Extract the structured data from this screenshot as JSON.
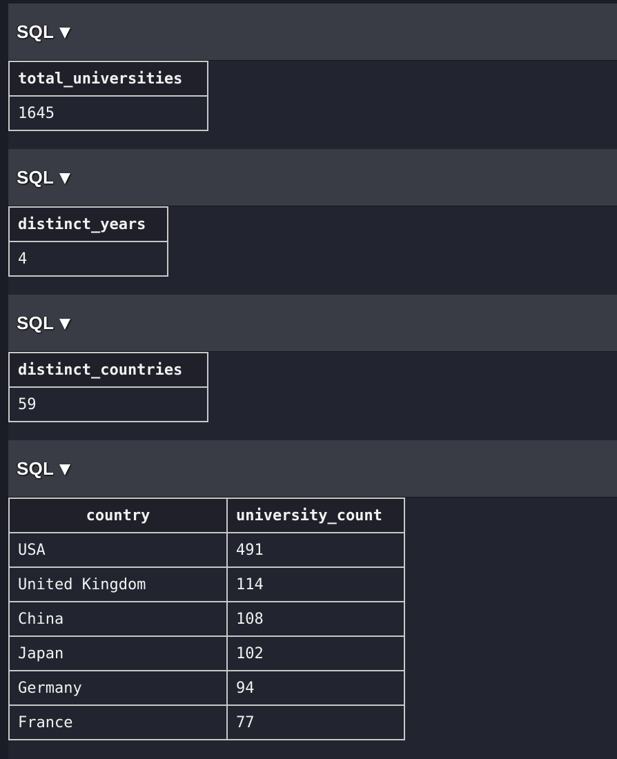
{
  "cells": [
    {
      "header": {
        "label": "SQL"
      },
      "columns": [
        "total_universities"
      ],
      "rows": [
        [
          "1645"
        ]
      ]
    },
    {
      "header": {
        "label": "SQL"
      },
      "columns": [
        "distinct_years"
      ],
      "rows": [
        [
          "4"
        ]
      ]
    },
    {
      "header": {
        "label": "SQL"
      },
      "columns": [
        "distinct_countries"
      ],
      "rows": [
        [
          "59"
        ]
      ]
    },
    {
      "header": {
        "label": "SQL"
      },
      "columns": [
        "country",
        "university_count"
      ],
      "rows": [
        [
          "USA",
          "491"
        ],
        [
          "United Kingdom",
          "114"
        ],
        [
          "China",
          "108"
        ],
        [
          "Japan",
          "102"
        ],
        [
          "Germany",
          "94"
        ],
        [
          "France",
          "77"
        ]
      ]
    }
  ]
}
